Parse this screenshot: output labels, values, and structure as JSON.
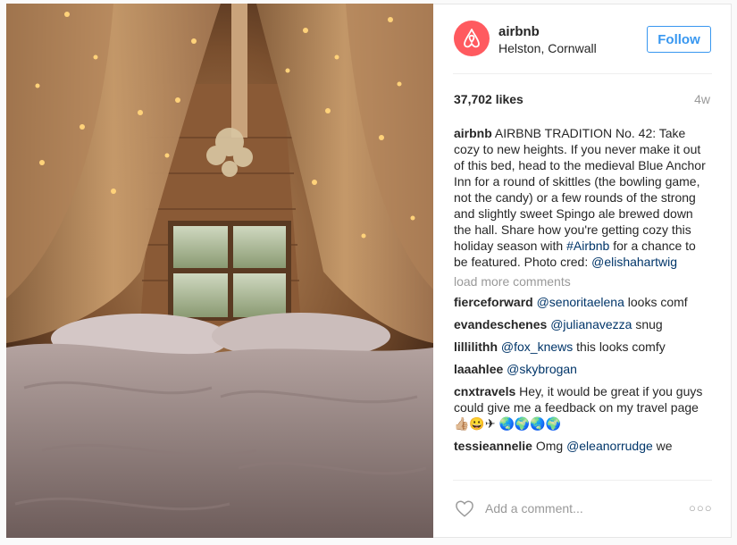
{
  "post": {
    "account": "airbnb",
    "location": "Helston, Cornwall",
    "follow_label": "Follow",
    "likes": "37,702 likes",
    "age": "4w",
    "caption_user": "airbnb",
    "caption_text": " AIRBNB TRADITION No. 42: Take cozy to new heights. If you never make it out of this bed, head to the medieval Blue Anchor Inn for a round of skittles (the bowling game, not the candy) or a few rounds of the strong and slightly sweet Spingo ale brewed down the hall. Share how you're getting cozy this holiday season with ",
    "caption_hashtag": "#Airbnb",
    "caption_text2": " for a chance to be featured. Photo cred: ",
    "caption_mention": "@elishahartwig",
    "load_more": "load more comments",
    "add_comment_placeholder": "Add a comment...",
    "more_options_icon": "ellipsis-icon",
    "brand_color": "#ff5a5f",
    "follow_color": "#3897f0",
    "link_color": "#003569"
  },
  "comments": [
    {
      "user": "fierceforward",
      "mention": "@senoritaelena",
      "text": " looks comf"
    },
    {
      "user": "evandeschenes",
      "mention": "@julianavezza",
      "text": " snug"
    },
    {
      "user": "lillilithh",
      "mention": "@fox_knews",
      "text": " this looks comfy"
    },
    {
      "user": "laaahlee",
      "mention": "@skybrogan",
      "text": ""
    },
    {
      "user": "cnxtravels",
      "mention": "",
      "text": " Hey, it would be great if you guys could give me a feedback on my travel page 👍🏼😀✈ 🌏🌍🌏🌍"
    },
    {
      "user": "tessieannelie",
      "mention": "",
      "text": " Omg ",
      "mention2": "@eleanorrudge",
      "text2": " we"
    }
  ]
}
